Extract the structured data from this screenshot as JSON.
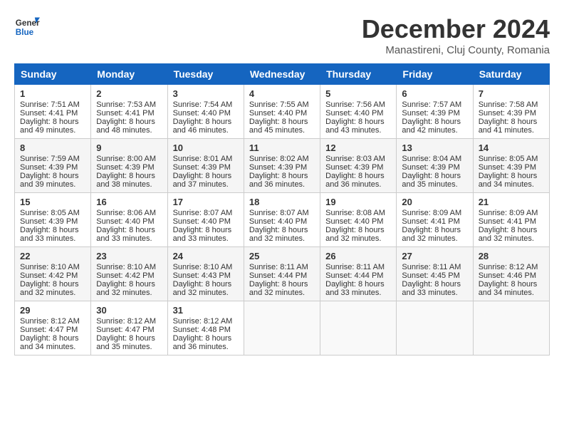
{
  "header": {
    "logo_general": "General",
    "logo_blue": "Blue",
    "month_title": "December 2024",
    "location": "Manastireni, Cluj County, Romania"
  },
  "days_of_week": [
    "Sunday",
    "Monday",
    "Tuesday",
    "Wednesday",
    "Thursday",
    "Friday",
    "Saturday"
  ],
  "weeks": [
    [
      {
        "day": "1",
        "sunrise": "Sunrise: 7:51 AM",
        "sunset": "Sunset: 4:41 PM",
        "daylight": "Daylight: 8 hours and 49 minutes."
      },
      {
        "day": "2",
        "sunrise": "Sunrise: 7:53 AM",
        "sunset": "Sunset: 4:41 PM",
        "daylight": "Daylight: 8 hours and 48 minutes."
      },
      {
        "day": "3",
        "sunrise": "Sunrise: 7:54 AM",
        "sunset": "Sunset: 4:40 PM",
        "daylight": "Daylight: 8 hours and 46 minutes."
      },
      {
        "day": "4",
        "sunrise": "Sunrise: 7:55 AM",
        "sunset": "Sunset: 4:40 PM",
        "daylight": "Daylight: 8 hours and 45 minutes."
      },
      {
        "day": "5",
        "sunrise": "Sunrise: 7:56 AM",
        "sunset": "Sunset: 4:40 PM",
        "daylight": "Daylight: 8 hours and 43 minutes."
      },
      {
        "day": "6",
        "sunrise": "Sunrise: 7:57 AM",
        "sunset": "Sunset: 4:39 PM",
        "daylight": "Daylight: 8 hours and 42 minutes."
      },
      {
        "day": "7",
        "sunrise": "Sunrise: 7:58 AM",
        "sunset": "Sunset: 4:39 PM",
        "daylight": "Daylight: 8 hours and 41 minutes."
      }
    ],
    [
      {
        "day": "8",
        "sunrise": "Sunrise: 7:59 AM",
        "sunset": "Sunset: 4:39 PM",
        "daylight": "Daylight: 8 hours and 39 minutes."
      },
      {
        "day": "9",
        "sunrise": "Sunrise: 8:00 AM",
        "sunset": "Sunset: 4:39 PM",
        "daylight": "Daylight: 8 hours and 38 minutes."
      },
      {
        "day": "10",
        "sunrise": "Sunrise: 8:01 AM",
        "sunset": "Sunset: 4:39 PM",
        "daylight": "Daylight: 8 hours and 37 minutes."
      },
      {
        "day": "11",
        "sunrise": "Sunrise: 8:02 AM",
        "sunset": "Sunset: 4:39 PM",
        "daylight": "Daylight: 8 hours and 36 minutes."
      },
      {
        "day": "12",
        "sunrise": "Sunrise: 8:03 AM",
        "sunset": "Sunset: 4:39 PM",
        "daylight": "Daylight: 8 hours and 36 minutes."
      },
      {
        "day": "13",
        "sunrise": "Sunrise: 8:04 AM",
        "sunset": "Sunset: 4:39 PM",
        "daylight": "Daylight: 8 hours and 35 minutes."
      },
      {
        "day": "14",
        "sunrise": "Sunrise: 8:05 AM",
        "sunset": "Sunset: 4:39 PM",
        "daylight": "Daylight: 8 hours and 34 minutes."
      }
    ],
    [
      {
        "day": "15",
        "sunrise": "Sunrise: 8:05 AM",
        "sunset": "Sunset: 4:39 PM",
        "daylight": "Daylight: 8 hours and 33 minutes."
      },
      {
        "day": "16",
        "sunrise": "Sunrise: 8:06 AM",
        "sunset": "Sunset: 4:40 PM",
        "daylight": "Daylight: 8 hours and 33 minutes."
      },
      {
        "day": "17",
        "sunrise": "Sunrise: 8:07 AM",
        "sunset": "Sunset: 4:40 PM",
        "daylight": "Daylight: 8 hours and 33 minutes."
      },
      {
        "day": "18",
        "sunrise": "Sunrise: 8:07 AM",
        "sunset": "Sunset: 4:40 PM",
        "daylight": "Daylight: 8 hours and 32 minutes."
      },
      {
        "day": "19",
        "sunrise": "Sunrise: 8:08 AM",
        "sunset": "Sunset: 4:40 PM",
        "daylight": "Daylight: 8 hours and 32 minutes."
      },
      {
        "day": "20",
        "sunrise": "Sunrise: 8:09 AM",
        "sunset": "Sunset: 4:41 PM",
        "daylight": "Daylight: 8 hours and 32 minutes."
      },
      {
        "day": "21",
        "sunrise": "Sunrise: 8:09 AM",
        "sunset": "Sunset: 4:41 PM",
        "daylight": "Daylight: 8 hours and 32 minutes."
      }
    ],
    [
      {
        "day": "22",
        "sunrise": "Sunrise: 8:10 AM",
        "sunset": "Sunset: 4:42 PM",
        "daylight": "Daylight: 8 hours and 32 minutes."
      },
      {
        "day": "23",
        "sunrise": "Sunrise: 8:10 AM",
        "sunset": "Sunset: 4:42 PM",
        "daylight": "Daylight: 8 hours and 32 minutes."
      },
      {
        "day": "24",
        "sunrise": "Sunrise: 8:10 AM",
        "sunset": "Sunset: 4:43 PM",
        "daylight": "Daylight: 8 hours and 32 minutes."
      },
      {
        "day": "25",
        "sunrise": "Sunrise: 8:11 AM",
        "sunset": "Sunset: 4:44 PM",
        "daylight": "Daylight: 8 hours and 32 minutes."
      },
      {
        "day": "26",
        "sunrise": "Sunrise: 8:11 AM",
        "sunset": "Sunset: 4:44 PM",
        "daylight": "Daylight: 8 hours and 33 minutes."
      },
      {
        "day": "27",
        "sunrise": "Sunrise: 8:11 AM",
        "sunset": "Sunset: 4:45 PM",
        "daylight": "Daylight: 8 hours and 33 minutes."
      },
      {
        "day": "28",
        "sunrise": "Sunrise: 8:12 AM",
        "sunset": "Sunset: 4:46 PM",
        "daylight": "Daylight: 8 hours and 34 minutes."
      }
    ],
    [
      {
        "day": "29",
        "sunrise": "Sunrise: 8:12 AM",
        "sunset": "Sunset: 4:47 PM",
        "daylight": "Daylight: 8 hours and 34 minutes."
      },
      {
        "day": "30",
        "sunrise": "Sunrise: 8:12 AM",
        "sunset": "Sunset: 4:47 PM",
        "daylight": "Daylight: 8 hours and 35 minutes."
      },
      {
        "day": "31",
        "sunrise": "Sunrise: 8:12 AM",
        "sunset": "Sunset: 4:48 PM",
        "daylight": "Daylight: 8 hours and 36 minutes."
      },
      null,
      null,
      null,
      null
    ]
  ]
}
